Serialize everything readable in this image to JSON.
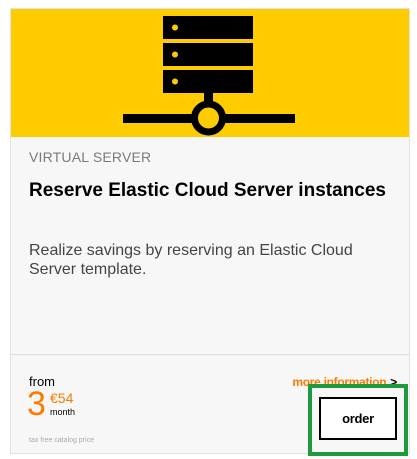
{
  "card": {
    "icon": "server-network-icon",
    "category": "VIRTUAL SERVER",
    "title": "Reserve Elastic Cloud Server instances",
    "description": "Realize savings by reserving an Elastic Cloud Server template.",
    "more_info": "more information",
    "more_info_chevron": ">",
    "from_label": "from",
    "price": {
      "integer": "3",
      "cents": "€54",
      "unit": "month"
    },
    "tax_note": "tax free catalog price",
    "order_label": "order"
  },
  "colors": {
    "banner": "#ffcc00",
    "accent": "#ff7900",
    "highlight": "#1e9b3e"
  }
}
